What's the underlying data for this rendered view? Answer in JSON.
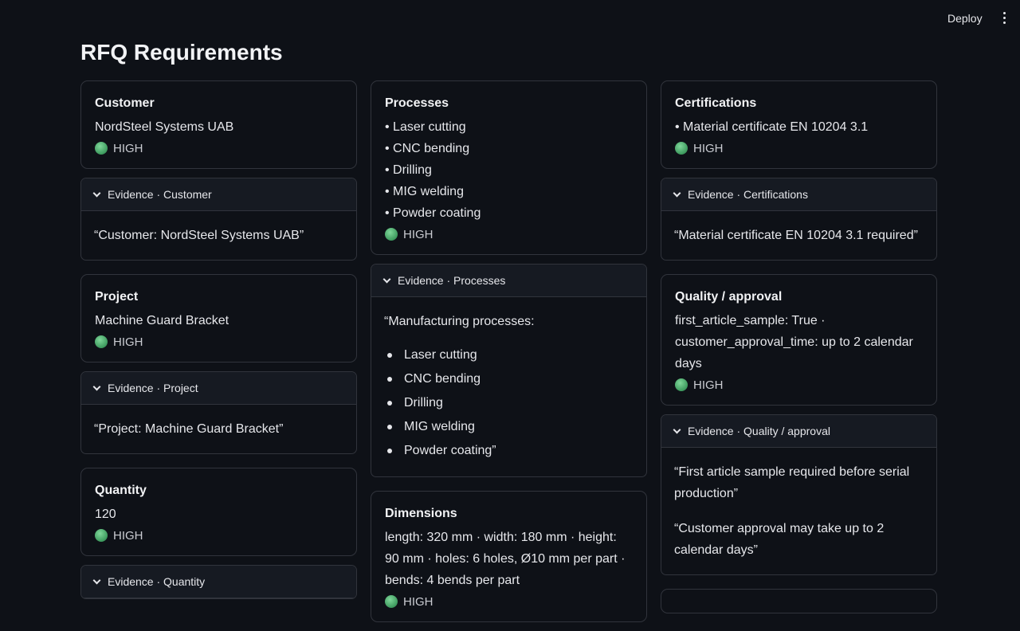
{
  "toolbar": {
    "deploy_label": "Deploy",
    "menu_icon": "vertical-dots-icon"
  },
  "page": {
    "title": "RFQ Requirements"
  },
  "confidence_color": "#4caf72",
  "columns": [
    [
      {
        "type": "card",
        "label": "Customer",
        "lines": [
          "NordSteel Systems UAB"
        ],
        "confidence": "HIGH"
      },
      {
        "type": "evidence",
        "header": "Evidence · Customer",
        "paragraphs": [
          "“Customer: NordSteel Systems UAB”"
        ]
      },
      {
        "type": "card",
        "label": "Project",
        "lines": [
          "Machine Guard Bracket"
        ],
        "confidence": "HIGH"
      },
      {
        "type": "evidence",
        "header": "Evidence · Project",
        "paragraphs": [
          "“Project: Machine Guard Bracket”"
        ]
      },
      {
        "type": "card",
        "label": "Quantity",
        "lines": [
          "120"
        ],
        "confidence": "HIGH"
      },
      {
        "type": "evidence",
        "header": "Evidence · Quantity",
        "paragraphs": []
      }
    ],
    [
      {
        "type": "card",
        "label": "Processes",
        "lines": [
          "• Laser cutting",
          "• CNC bending",
          "• Drilling",
          "• MIG welding",
          "• Powder coating"
        ],
        "confidence": "HIGH"
      },
      {
        "type": "evidence",
        "header": "Evidence · Processes",
        "paragraphs": [
          "“Manufacturing processes:"
        ],
        "list": [
          "Laser cutting",
          "CNC bending",
          "Drilling",
          "MIG welding",
          "Powder coating”"
        ]
      },
      {
        "type": "card",
        "label": "Dimensions",
        "lines": [
          "length: 320 mm · width: 180 mm · height: 90 mm · holes: 6 holes, Ø10 mm per part · bends: 4 bends per part"
        ],
        "confidence": "HIGH"
      }
    ],
    [
      {
        "type": "card",
        "label": "Certifications",
        "lines": [
          "• Material certificate EN 10204 3.1"
        ],
        "confidence": "HIGH"
      },
      {
        "type": "evidence",
        "header": "Evidence · Certifications",
        "paragraphs": [
          "“Material certificate EN 10204 3.1 required”"
        ]
      },
      {
        "type": "card",
        "label": "Quality / approval",
        "lines": [
          "first_article_sample: True · customer_approval_time: up to 2 calendar days"
        ],
        "confidence": "HIGH"
      },
      {
        "type": "evidence",
        "header": "Evidence · Quality / approval",
        "paragraphs": [
          "“First article sample required before serial production”",
          "“Customer approval may take up to 2 calendar days”"
        ]
      },
      {
        "type": "card",
        "label": "",
        "lines": [],
        "confidence": ""
      }
    ]
  ]
}
